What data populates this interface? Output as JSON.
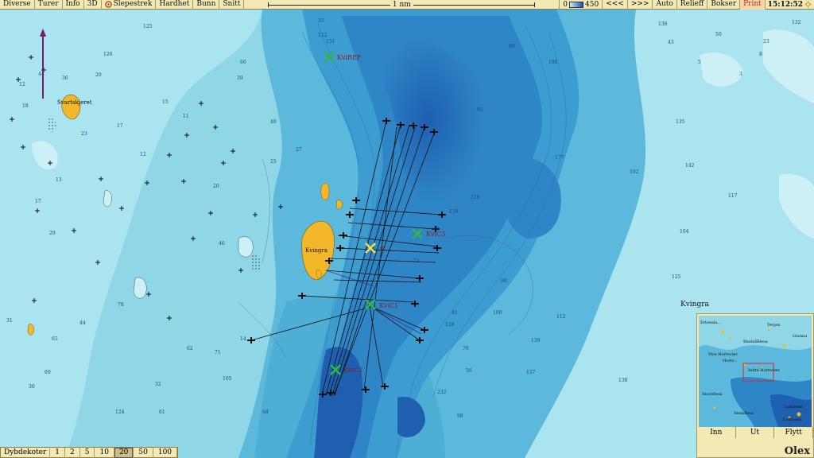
{
  "toolbar": {
    "buttons": [
      "Diverse",
      "Turer",
      "Info",
      "3D",
      "Slepestrek",
      "Hardhet",
      "Bunn",
      "Snitt"
    ],
    "scale_label": "1 nm",
    "depth_min": "0",
    "depth_max": "450",
    "right_buttons": [
      "<<<",
      ">>>",
      "Auto",
      "Relieff",
      "Bokser"
    ],
    "print_label": "Print",
    "clock": "15:12:52"
  },
  "depth_selector": {
    "label": "Dybdekoter",
    "options": [
      "1",
      "2",
      "5",
      "10",
      "20",
      "50",
      "100"
    ],
    "selected": "20"
  },
  "place_names": {
    "svartskjeret": "Svartskjeret",
    "kvingra_island": "Kvingra",
    "kvingra_region": "Kvingra"
  },
  "markers": {
    "kviref": "KviREF",
    "kvic3": "KviC3",
    "s": "S",
    "kvic1": "KviC1",
    "kvic2": "KviC2"
  },
  "soundings": [
    "125",
    "126",
    "138",
    "132",
    "142",
    "135",
    "20",
    "36",
    "12",
    "44",
    "39",
    "11",
    "17",
    "25",
    "15",
    "40",
    "27",
    "72",
    "95",
    "88",
    "66",
    "35",
    "122",
    "102",
    "104",
    "125",
    "117",
    "14",
    "23",
    "18",
    "12",
    "30",
    "32",
    "29",
    "69",
    "61",
    "65",
    "20",
    "44",
    "68",
    "105",
    "62",
    "78",
    "100",
    "71",
    "46",
    "17",
    "31",
    "13",
    "124",
    "130",
    "151",
    "180",
    "177",
    "216",
    "232",
    "139",
    "137",
    "112",
    "138",
    "128",
    "76",
    "90",
    "69",
    "41",
    "43",
    "50",
    "98",
    "56",
    "23",
    "5",
    "3",
    "8"
  ],
  "overview": {
    "labels": [
      "Ertensla...",
      "Tevjen",
      "Glunna",
      "Bindslåflesa",
      "Ytre Hortevær",
      "Hortv...",
      "Indre Hortevær",
      "Storeflesa",
      "Lokiesen",
      "Lofbauen",
      "Steinflesa"
    ],
    "buttons": [
      "Inn",
      "Ut",
      "Flytt"
    ],
    "brand": "Olex"
  },
  "colors": {
    "toolbar_bg": "#f3e9b5",
    "shallow": "#a9e4ef",
    "mid": "#5cb9db",
    "deep": "#2f86c7",
    "deepest": "#1e5fb0",
    "land": "#f2b829",
    "marker_green": "#2db84a",
    "marker_yellow": "#f1e04a",
    "marker_label": "#8b1a1a"
  }
}
